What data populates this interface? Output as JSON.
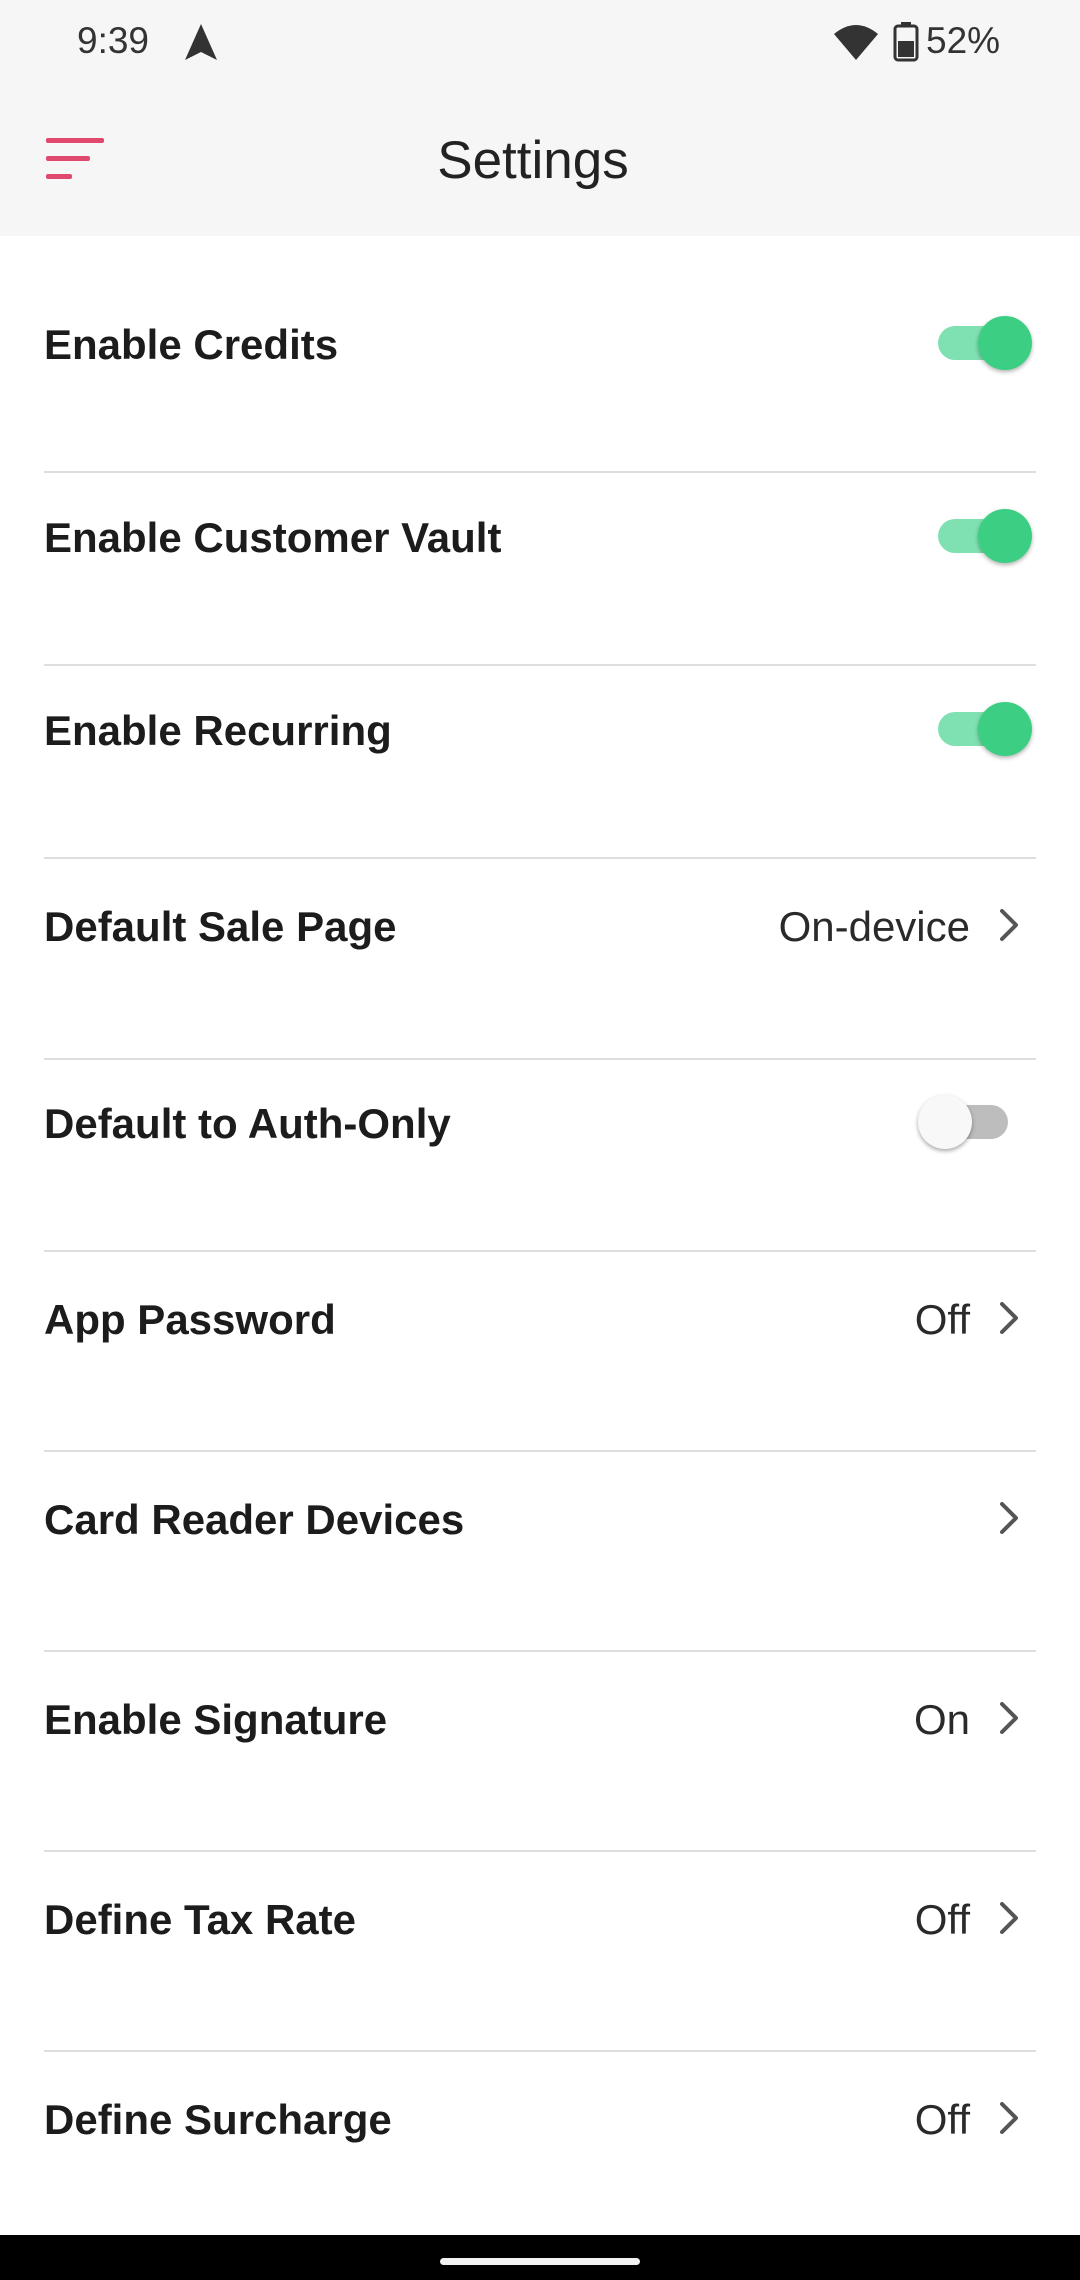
{
  "status_bar": {
    "time": "9:39",
    "battery_percent": "52%",
    "icons": [
      "navigation-arrow-icon",
      "wifi-icon",
      "battery-icon"
    ]
  },
  "app_bar": {
    "title": "Settings",
    "menu_icon": "menu-icon",
    "accent_color": "#e0486d"
  },
  "colors": {
    "toggle_on_thumb": "#3ccf84",
    "toggle_on_track": "#7fe1b1",
    "toggle_off_thumb": "#f8f8f8",
    "toggle_off_track": "#bdbdbd"
  },
  "settings": [
    {
      "label": "Enable Credits",
      "type": "toggle",
      "checked": true
    },
    {
      "label": "Enable Customer Vault",
      "type": "toggle",
      "checked": true
    },
    {
      "label": "Enable Recurring",
      "type": "toggle",
      "checked": true
    },
    {
      "label": "Default Sale Page",
      "type": "nav",
      "value": "On-device"
    },
    {
      "label": "Default to Auth-Only",
      "type": "toggle",
      "checked": false
    },
    {
      "label": "App Password",
      "type": "nav",
      "value": "Off"
    },
    {
      "label": "Card Reader Devices",
      "type": "nav",
      "value": ""
    },
    {
      "label": "Enable Signature",
      "type": "nav",
      "value": "On"
    },
    {
      "label": "Define Tax Rate",
      "type": "nav",
      "value": "Off"
    },
    {
      "label": "Define Surcharge",
      "type": "nav",
      "value": "Off"
    }
  ]
}
